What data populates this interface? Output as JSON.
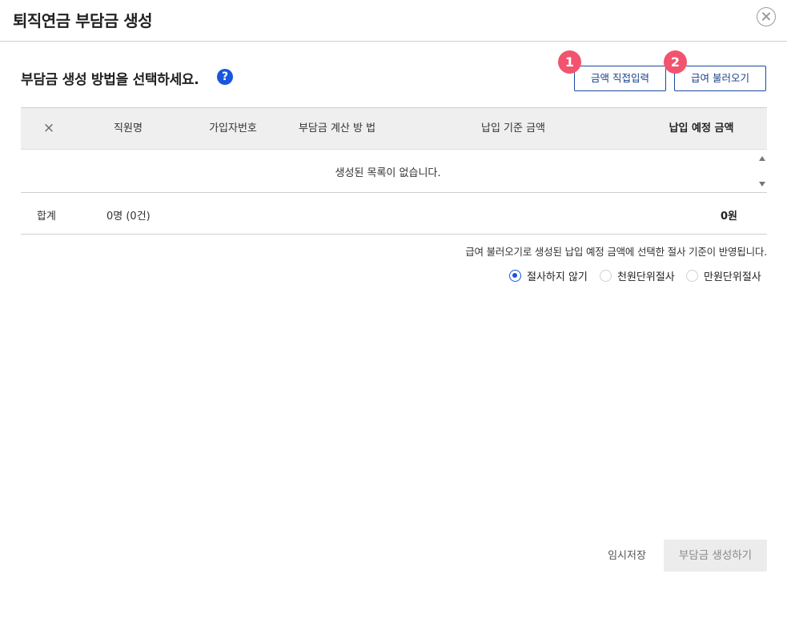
{
  "dialog": {
    "title": "퇴직연금 부담금 생성",
    "close_icon": "close-circle-icon"
  },
  "method": {
    "title": "부담금 생성 방법을 선택하세요.",
    "help_label": "?",
    "buttons": {
      "direct_input": {
        "badge": "1",
        "label": "금액 직접입력"
      },
      "load_salary": {
        "badge": "2",
        "label": "급여 불러오기"
      }
    }
  },
  "table": {
    "headers": {
      "remove": "×",
      "employee_name": "직원명",
      "member_no": "가입자번호",
      "calc_method": "부담금 계산 방 법",
      "base_amount": "납입 기준 금액",
      "due_amount": "납입 예정 금액"
    },
    "empty_message": "생성된 목록이 없습니다.",
    "footer": {
      "label": "합계",
      "count": "0명 (0건)",
      "total": "0원"
    }
  },
  "rounding": {
    "notice": "급여 불러오기로 생성된 납입 예정 금액에 선택한 절사 기준이 반영됩니다.",
    "options": [
      {
        "label": "절사하지 않기",
        "selected": true
      },
      {
        "label": "천원단위절사",
        "selected": false
      },
      {
        "label": "만원단위절사",
        "selected": false
      }
    ]
  },
  "actions": {
    "temp_save": "임시저장",
    "create": "부담금 생성하기"
  },
  "colors": {
    "accent": "#1a56db",
    "badge": "#f2536e",
    "outline_button": "#1a4a9c",
    "disabled_button_bg": "#ececec"
  }
}
